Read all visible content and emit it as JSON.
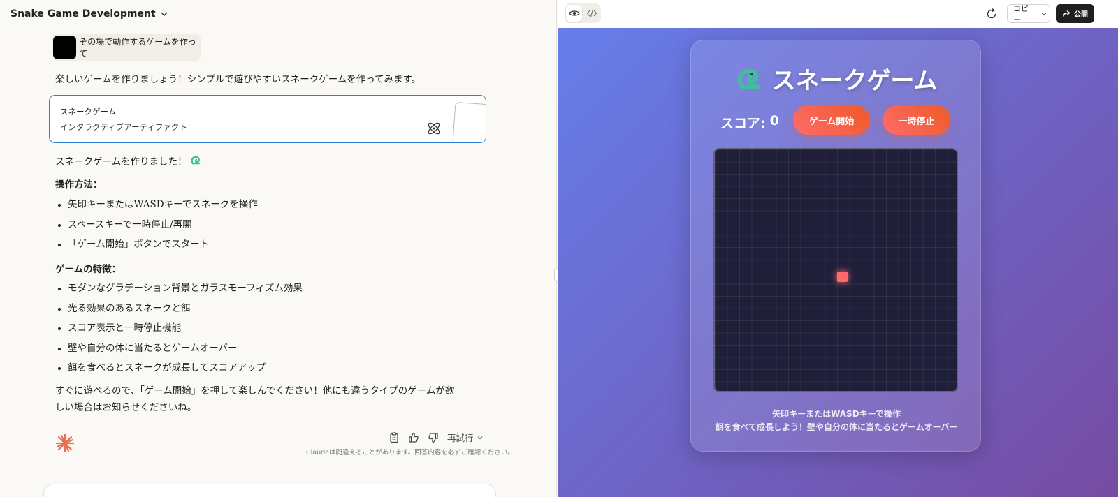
{
  "chat": {
    "title": "Snake Game Development",
    "user_message": "その場で動作するゲームを作って",
    "intro": "楽しいゲームを作りましょう！シンプルで遊びやすいスネークゲームを作ってみます。",
    "artifact": {
      "title": "スネークゲーム",
      "subtitle": "インタラクティブアーティファクト"
    },
    "done_text": "スネークゲームを作りました！",
    "controls_heading": "操作方法：",
    "controls": [
      "矢印キーまたはWASDキーでスネークを操作",
      "スペースキーで一時停止/再開",
      "「ゲーム開始」ボタンでスタート"
    ],
    "features_heading": "ゲームの特徴：",
    "features": [
      "モダンなグラデーション背景とガラスモーフィズム効果",
      "光る効果のあるスネークと餌",
      "スコア表示と一時停止機能",
      "壁や自分の体に当たるとゲームオーバー",
      "餌を食べるとスネークが成長してスコアアップ"
    ],
    "closing_line1": "すぐに遊べるので、「ゲーム開始」を押して楽しんでください！他にも違うタイプのゲームが欲",
    "closing_line2": "しい場合はお知らせくださいね。",
    "retry_label": "再試行",
    "disclaimer": "Claudeは間違えることがあります。回答内容を必ずご確認ください。"
  },
  "toolbar": {
    "copy_label": "コピー",
    "publish_label": "公開"
  },
  "game": {
    "title": "スネークゲーム",
    "score_label": "スコア:",
    "score_value": "0",
    "start_button": "ゲーム開始",
    "pause_button": "一時停止",
    "instruction1": "矢印キーまたはWASDキーで操作",
    "instruction2": "餌を食べて成長しよう！壁や自分の体に当たるとゲームオーバー"
  },
  "colors": {
    "accent_blue": "#2f7fd6",
    "button_gradient_start": "#ff6b6b",
    "button_gradient_end": "#ee5a24",
    "stage_gradient_start": "#667eea",
    "stage_gradient_end": "#764ba2",
    "board_bg": "#1f1f3a",
    "food": "#ff6b6b",
    "snake_icon": "#3fbf9b",
    "spark": "#e4704f"
  }
}
